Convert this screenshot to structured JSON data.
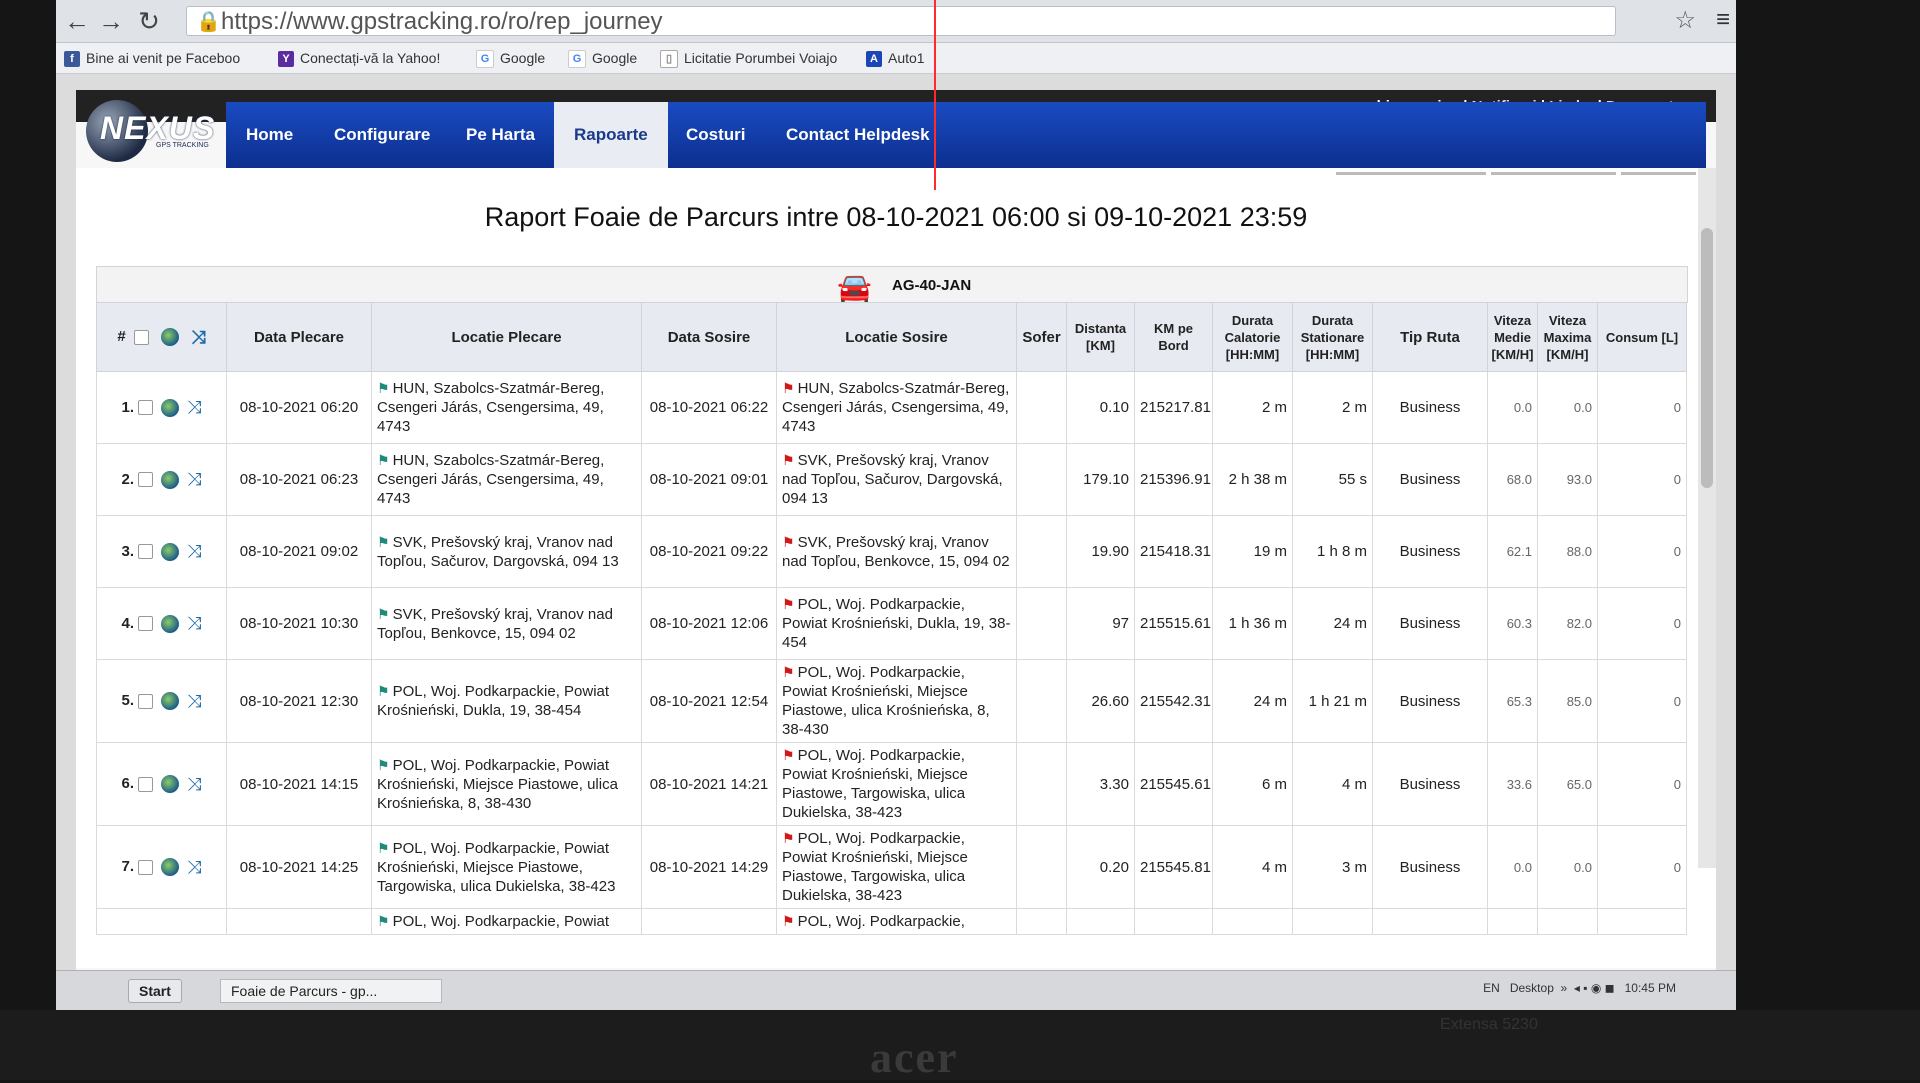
{
  "browser": {
    "url": "https://www.gpstracking.ro/ro/rep_journey",
    "bookmarks": [
      {
        "icon": "facebook-icon",
        "label": "Bine ai venit pe Faceboo"
      },
      {
        "icon": "yahoo-icon",
        "label": "Conectați-vă la Yahoo!"
      },
      {
        "icon": "google-icon",
        "label": "Google"
      },
      {
        "icon": "google-icon",
        "label": "Google"
      },
      {
        "icon": "page-icon",
        "label": "Licitatie Porumbei Voiajo"
      },
      {
        "icon": "autoro-icon",
        "label": "Auto1"
      }
    ]
  },
  "userbar": {
    "user": "achimescujan",
    "links": [
      "Notificari",
      "Limba",
      "Deconectare"
    ]
  },
  "logo": {
    "text": "NEXUS",
    "sub": "GPS TRACKING"
  },
  "nav": [
    "Home",
    "Configurare",
    "Pe Harta",
    "Rapoarte",
    "Costuri",
    "Contact Helpdesk"
  ],
  "nav_active": "Rapoarte",
  "report": {
    "title": "Raport Foaie de Parcurs intre 08-10-2021 06:00 si 09-10-2021 23:59",
    "vehicle": "AG-40-JAN",
    "headers": {
      "num": "#",
      "data_plecare": "Data Plecare",
      "locatie_plecare": "Locatie Plecare",
      "data_sosire": "Data Sosire",
      "locatie_sosire": "Locatie Sosire",
      "sofer": "Sofer",
      "distanta": "Distanta [KM]",
      "km_bord": "KM pe Bord",
      "durata_calatorie": "Durata Calatorie [HH:MM]",
      "durata_stationare": "Durata Stationare [HH:MM]",
      "tip_ruta": "Tip Ruta",
      "viteza_medie": "Viteza Medie [KM/H]",
      "viteza_maxima": "Viteza Maxima [KM/H]",
      "consum": "Consum [L]"
    },
    "rows": [
      {
        "n": "1.",
        "dp": "08-10-2021 06:20",
        "lp": "HUN, Szabolcs-Szatmár-Bereg, Csengeri Járás, Csengersima, 49, 4743",
        "ds": "08-10-2021 06:22",
        "ls": "HUN, Szabolcs-Szatmár-Bereg, Csengeri Járás, Csengersima, 49, 4743",
        "sofer": "",
        "dist": "0.10",
        "km": "215217.81",
        "dc": "2 m",
        "dst": "2 m",
        "tip": "Business",
        "vm": "0.0",
        "vx": "0.0",
        "c": "0"
      },
      {
        "n": "2.",
        "dp": "08-10-2021 06:23",
        "lp": "HUN, Szabolcs-Szatmár-Bereg, Csengeri Járás, Csengersima, 49, 4743",
        "ds": "08-10-2021 09:01",
        "ls": "SVK, Prešovský kraj, Vranov nad Topľou, Sačurov, Dargovská, 094 13",
        "sofer": "",
        "dist": "179.10",
        "km": "215396.91",
        "dc": "2 h 38 m",
        "dst": "55 s",
        "tip": "Business",
        "vm": "68.0",
        "vx": "93.0",
        "c": "0"
      },
      {
        "n": "3.",
        "dp": "08-10-2021 09:02",
        "lp": "SVK, Prešovský kraj, Vranov nad Topľou, Sačurov, Dargovská, 094 13",
        "ds": "08-10-2021 09:22",
        "ls": "SVK, Prešovský kraj, Vranov nad Topľou, Benkovce, 15, 094 02",
        "sofer": "",
        "dist": "19.90",
        "km": "215418.31",
        "dc": "19 m",
        "dst": "1 h 8 m",
        "tip": "Business",
        "vm": "62.1",
        "vx": "88.0",
        "c": "0"
      },
      {
        "n": "4.",
        "dp": "08-10-2021 10:30",
        "lp": "SVK, Prešovský kraj, Vranov nad Topľou, Benkovce, 15, 094 02",
        "ds": "08-10-2021 12:06",
        "ls": "POL, Woj. Podkarpackie, Powiat Krośnieński, Dukla, 19, 38-454",
        "sofer": "",
        "dist": "97",
        "km": "215515.61",
        "dc": "1 h 36 m",
        "dst": "24 m",
        "tip": "Business",
        "vm": "60.3",
        "vx": "82.0",
        "c": "0"
      },
      {
        "n": "5.",
        "dp": "08-10-2021 12:30",
        "lp": "POL, Woj. Podkarpackie, Powiat Krośnieński, Dukla, 19, 38-454",
        "ds": "08-10-2021 12:54",
        "ls": "POL, Woj. Podkarpackie, Powiat Krośnieński, Miejsce Piastowe, ulica Krośnieńska, 8, 38-430",
        "sofer": "",
        "dist": "26.60",
        "km": "215542.31",
        "dc": "24 m",
        "dst": "1 h 21 m",
        "tip": "Business",
        "vm": "65.3",
        "vx": "85.0",
        "c": "0"
      },
      {
        "n": "6.",
        "dp": "08-10-2021 14:15",
        "lp": "POL, Woj. Podkarpackie, Powiat Krośnieński, Miejsce Piastowe, ulica Krośnieńska, 8, 38-430",
        "ds": "08-10-2021 14:21",
        "ls": "POL, Woj. Podkarpackie, Powiat Krośnieński, Miejsce Piastowe, Targowiska, ulica Dukielska, 38-423",
        "sofer": "",
        "dist": "3.30",
        "km": "215545.61",
        "dc": "6 m",
        "dst": "4 m",
        "tip": "Business",
        "vm": "33.6",
        "vx": "65.0",
        "c": "0"
      },
      {
        "n": "7.",
        "dp": "08-10-2021 14:25",
        "lp": "POL, Woj. Podkarpackie, Powiat Krośnieński, Miejsce Piastowe, Targowiska, ulica Dukielska, 38-423",
        "ds": "08-10-2021 14:29",
        "ls": "POL, Woj. Podkarpackie, Powiat Krośnieński, Miejsce Piastowe, Targowiska, ulica Dukielska, 38-423",
        "sofer": "",
        "dist": "0.20",
        "km": "215545.81",
        "dc": "4 m",
        "dst": "3 m",
        "tip": "Business",
        "vm": "0.0",
        "vx": "0.0",
        "c": "0"
      }
    ],
    "partial_row": {
      "lp": "POL, Woj. Podkarpackie, Powiat",
      "ls": "POL, Woj. Podkarpackie,"
    }
  },
  "taskbar": {
    "start": "Start",
    "task": "Foaie de Parcurs - gp...",
    "tray_desktop": "Desktop",
    "lang": "EN",
    "time": "10:45 PM"
  },
  "monitor": {
    "brand": "acer",
    "model": "Extensa 5230"
  }
}
